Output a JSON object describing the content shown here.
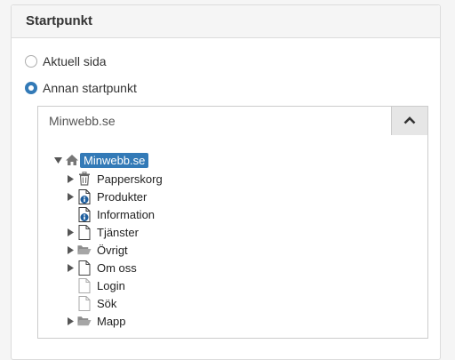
{
  "panel": {
    "title": "Startpunkt"
  },
  "options": {
    "current_page": {
      "label": "Aktuell sida",
      "checked": false
    },
    "other_start": {
      "label": "Annan startpunkt",
      "checked": true
    }
  },
  "combo": {
    "value": "Minwebb.se",
    "toggle_icon": "chevron-up-icon"
  },
  "tree": {
    "root": {
      "label": "Minwebb.se",
      "icon": "home-icon",
      "expanded": true,
      "selected": true
    },
    "items": [
      {
        "label": "Papperskorg",
        "icon": "trash-icon",
        "has_children": true
      },
      {
        "label": "Produkter",
        "icon": "page-info-icon",
        "has_children": true
      },
      {
        "label": "Information",
        "icon": "page-info-icon",
        "has_children": false
      },
      {
        "label": "Tjänster",
        "icon": "page-icon",
        "has_children": true
      },
      {
        "label": "Övrigt",
        "icon": "folder-icon",
        "has_children": true
      },
      {
        "label": "Om oss",
        "icon": "page-icon",
        "has_children": true
      },
      {
        "label": "Login",
        "icon": "page-icon",
        "has_children": false
      },
      {
        "label": "Sök",
        "icon": "page-icon",
        "has_children": false
      },
      {
        "label": "Mapp",
        "icon": "folder-icon",
        "has_children": true
      }
    ]
  },
  "colors": {
    "accent": "#337ab7",
    "panel_header_bg": "#f5f5f5",
    "border": "#dcdcdc"
  }
}
